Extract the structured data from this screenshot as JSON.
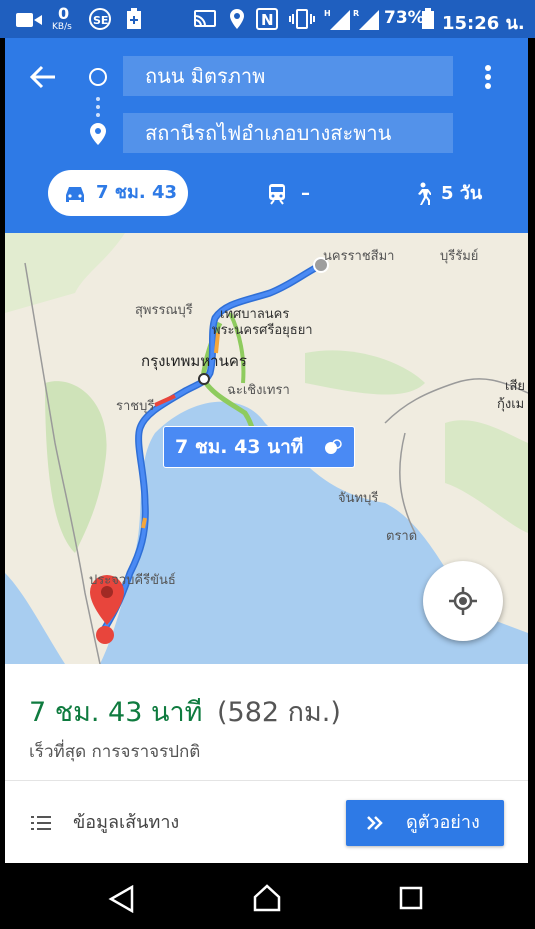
{
  "status_bar": {
    "speed_value": "0",
    "speed_unit": "KB/s",
    "battery": "73%",
    "time": "15:26 น."
  },
  "directions": {
    "origin": "ถนน มิตรภาพ",
    "destination": "สถานีรถไฟอำเภอบางสะพาน"
  },
  "modes": {
    "drive": "7 ชม. 43",
    "transit": "–",
    "walk": "5 วัน"
  },
  "map": {
    "labels": {
      "nakhon_ratchasima": "นครราชสีมา",
      "buriram": "บุรีรัมย์",
      "suphanburi": "สุพรรณบุรี",
      "thesaban_1": "เทศบาลนคร",
      "ayutthaya": "พระนครศรีอยุธยา",
      "bangkok": "กรุงเทพมหานคร",
      "chachoengsao": "ฉะเชิงเทรา",
      "ratchaburi": "ราชบุรี",
      "chanthaburi": "จันทบุรี",
      "trat": "ตราด",
      "prachuap": "ประจวบคีรีขันธ์",
      "siem_reap_1": "เสีย",
      "siem_reap_2": "กุ้งเม"
    },
    "route_label": "7 ชม. 43 นาที"
  },
  "summary": {
    "duration": "7 ชม. 43 นาที",
    "distance": "(582 กม.)",
    "note": "เร็วที่สุด การจราจรปกติ"
  },
  "actions": {
    "steps": "ข้อมูลเส้นทาง",
    "preview": "ดูตัวอย่าง"
  },
  "colors": {
    "header_blue": "#2e7ae6",
    "route_blue": "#4a8af4",
    "duration_green": "#0f7b3f",
    "pin_red": "#e8453c"
  }
}
